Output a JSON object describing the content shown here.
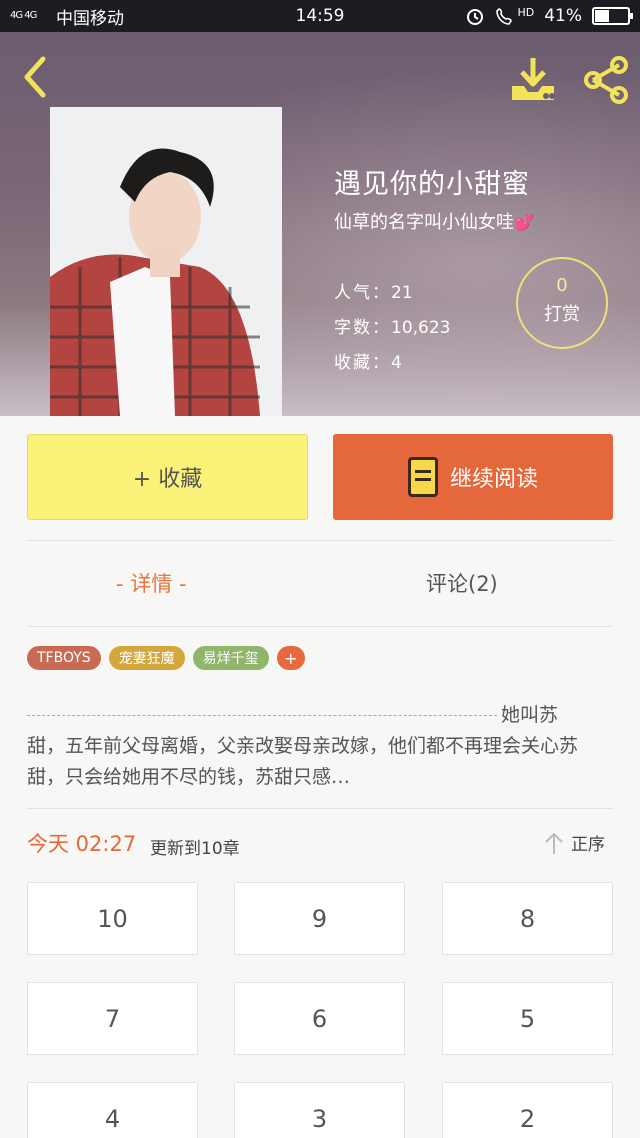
{
  "status_bar": {
    "signal": "4G 4G",
    "carrier": "中国移动",
    "time": "14:59",
    "hd": "HD",
    "battery": "41%",
    "battery_level": 0.41
  },
  "book": {
    "title": "遇见你的小甜蜜",
    "author": "仙草的名字叫小仙女哇",
    "author_emoji": "💕",
    "popularity_label": "人气：",
    "popularity": "21",
    "words_label": "字数：",
    "words": "10,623",
    "favorites_label": "收藏：",
    "favorites": "4",
    "tip_count": "0",
    "tip_label": "打赏"
  },
  "actions": {
    "favorite": "+ 收藏",
    "continue_reading": "继续阅读"
  },
  "tabs": {
    "details": "- 详情 -",
    "comments": "评论(2)"
  },
  "tags": [
    "TFBOYS",
    "宠妻狂魔",
    "易烊千玺",
    "+"
  ],
  "synopsis": {
    "line1": "她叫苏",
    "rest": "甜，五年前父母离婚，父亲改娶母亲改嫁，他们都不再理会关心苏甜，只会给她用不尽的钱，苏甜只感…"
  },
  "update": {
    "today": "今天 02:27",
    "text": "更新到10章",
    "sort": "正序"
  },
  "chapters": [
    "10",
    "9",
    "8",
    "7",
    "6",
    "5",
    "4",
    "3",
    "2"
  ],
  "colors": {
    "accent": "#e5673c",
    "favorite_button": "#fbf27a",
    "tip_ring": "#f0e07a"
  },
  "icons": [
    "back-icon",
    "download-icon",
    "share-icon",
    "book-icon",
    "sort-up-icon"
  ]
}
